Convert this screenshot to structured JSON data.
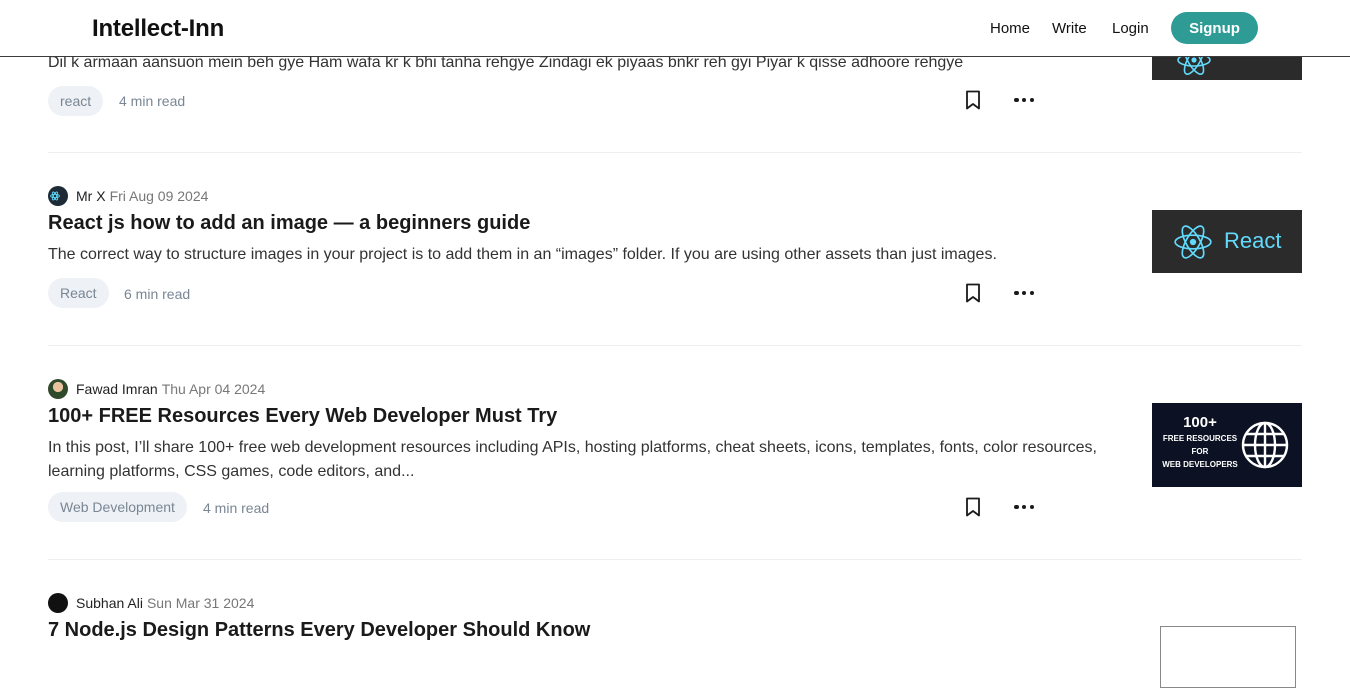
{
  "nav": {
    "brand": "Intellect-Inn",
    "home": "Home",
    "write": "Write",
    "login": "Login",
    "signup": "Signup"
  },
  "articles": [
    {
      "excerpt": "Dil k armaan aansuon mein beh gye Ham wafa kr k bhi tanha rehgye Zindagi ek piyaas bnkr reh gyi Piyar k qisse adhoore rehgye",
      "tag": "react",
      "read_time": "4 min read"
    },
    {
      "author": "Mr X",
      "date": "Fri Aug 09 2024",
      "title": "React js how to add an image — a beginners guide",
      "excerpt": "The correct way to structure images in your project is to add them in an “images” folder. If you are using other assets than just images.",
      "tag": "React",
      "read_time": "6 min read",
      "thumb_text": "React"
    },
    {
      "author": "Fawad Imran",
      "date": "Thu Apr 04 2024",
      "title": "100+ FREE Resources Every Web Developer Must Try",
      "excerpt": "In this post, I’ll share 100+ free web development resources including APIs, hosting platforms, cheat sheets, icons, templates, fonts, color resources, learning platforms, CSS games, code editors, and...",
      "tag": "Web Development",
      "read_time": "4 min read",
      "thumb_lines": [
        "100+",
        "FREE RESOURCES",
        "FOR",
        "WEB DEVELOPERS"
      ]
    },
    {
      "author": "Subhan Ali",
      "date": "Sun Mar 31 2024",
      "title": "7 Node.js Design Patterns Every Developer Should Know"
    }
  ],
  "icons": {
    "bookmark": "bookmark-icon",
    "more": "more-icon",
    "react_logo": "react-logo-icon",
    "globe": "globe-icon"
  },
  "colors": {
    "accent": "#2e9b94",
    "tag_bg": "#eef1f6",
    "thumb_dark": "#2b2b2b",
    "thumb_navy": "#0c1224",
    "react_blue": "#61dafb"
  }
}
